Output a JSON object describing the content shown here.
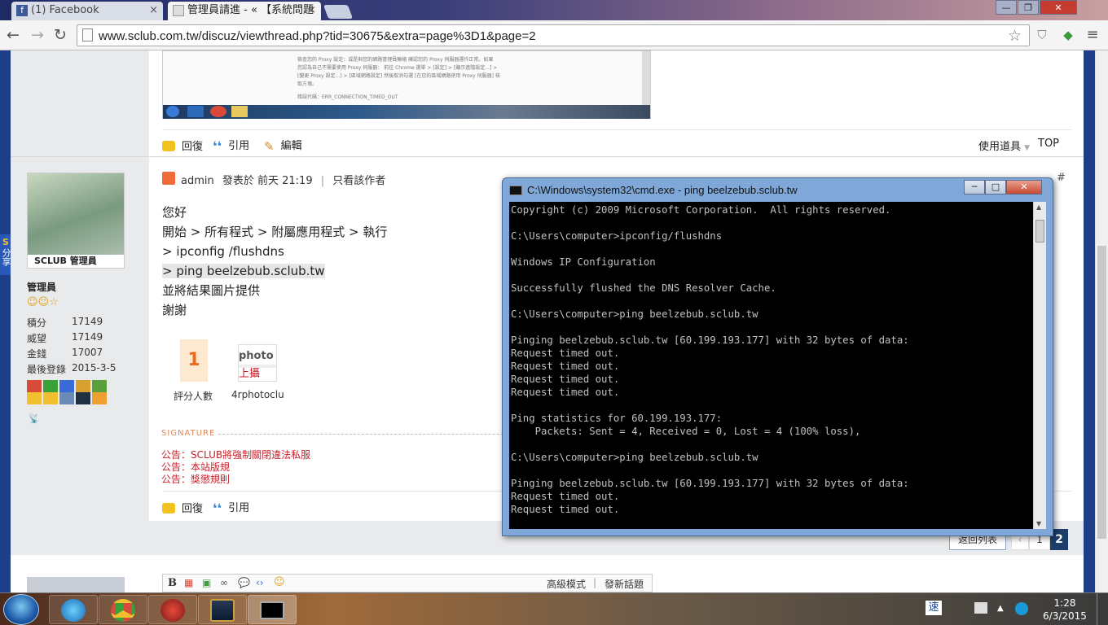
{
  "browser": {
    "tabs": [
      {
        "title": "(1) Facebook",
        "close": "×"
      },
      {
        "title": "管理員請進 - « 【系統問題",
        "close": "×"
      }
    ],
    "url": "www.sclub.com.tw/discuz/viewthread.php?tid=30675&extra=page%3D1&page=2",
    "window_controls": [
      "—",
      "❐",
      "✕"
    ]
  },
  "side_share": "分享",
  "top_post": {
    "screenshot_text": [
      "檢查您的 Proxy 設定：或是與您的網路管理員聯絡 確認您的 Proxy 伺服器運作正常。如果",
      "您認為自己不需要使用 Proxy 伺服器： 前往 Chrome 選單 > [設定] > [顯示進階設定...] >",
      "[變更 Proxy 設定...] > [區域網路設定] 然後取消勾選 [在您的區域網路使用 Proxy 伺服器] 核",
      "取方塊。",
      "錯誤代碼：ERR_CONNECTION_TIMED_OUT"
    ],
    "actions": {
      "reply": "回復",
      "quote": "引用",
      "edit": "編輯",
      "tools": "使用道具",
      "top": "TOP"
    }
  },
  "post": {
    "author": "admin",
    "posted": "發表於 前天 21:19",
    "sep": "|",
    "only_author": "只看該作者",
    "floor": "#",
    "body": [
      "您好",
      "開始 > 所有程式 > 附屬應用程式 > 執行",
      "> ipconfig /flushdns",
      "> ping beelzebub.sclub.tw",
      "並將結果圖片提供",
      "謝謝"
    ],
    "rating_count": "1",
    "rating_label": "評分人數",
    "rater_name": "4rphotoclu",
    "signature_label": "SIGNATURE",
    "announcements": [
      "公告：SCLUB將強制關閉違法私服",
      "公告：本站版規",
      "公告：獎懲規則"
    ],
    "actions": {
      "reply": "回復",
      "quote": "引用"
    }
  },
  "user": {
    "avatar_label": "SCLUB 管理員",
    "name": "管理員",
    "stats": [
      {
        "label": "積分",
        "value": "17149"
      },
      {
        "label": "威望",
        "value": "17149"
      },
      {
        "label": "金錢",
        "value": "17007"
      },
      {
        "label": "最後登錄",
        "value": "2015-3-5"
      }
    ]
  },
  "pagination": {
    "back": "返回列表",
    "prev": "‹",
    "pages": [
      "1",
      "2"
    ],
    "current": "2"
  },
  "editor": {
    "advanced": "高級模式",
    "sep": "|",
    "new_topic": "發新話題"
  },
  "cmd": {
    "title": "C:\\Windows\\system32\\cmd.exe - ping  beelzebub.sclub.tw",
    "output": "Copyright (c) 2009 Microsoft Corporation.  All rights reserved.\n\nC:\\Users\\computer>ipconfig/flushdns\n\nWindows IP Configuration\n\nSuccessfully flushed the DNS Resolver Cache.\n\nC:\\Users\\computer>ping beelzebub.sclub.tw\n\nPinging beelzebub.sclub.tw [60.199.193.177] with 32 bytes of data:\nRequest timed out.\nRequest timed out.\nRequest timed out.\nRequest timed out.\n\nPing statistics for 60.199.193.177:\n    Packets: Sent = 4, Received = 0, Lost = 4 (100% loss),\n\nC:\\Users\\computer>ping beelzebub.sclub.tw\n\nPinging beelzebub.sclub.tw [60.199.193.177] with 32 bytes of data:\nRequest timed out.\nRequest timed out."
  },
  "taskbar": {
    "ime": "速",
    "time": "1:28",
    "date": "6/3/2015"
  }
}
